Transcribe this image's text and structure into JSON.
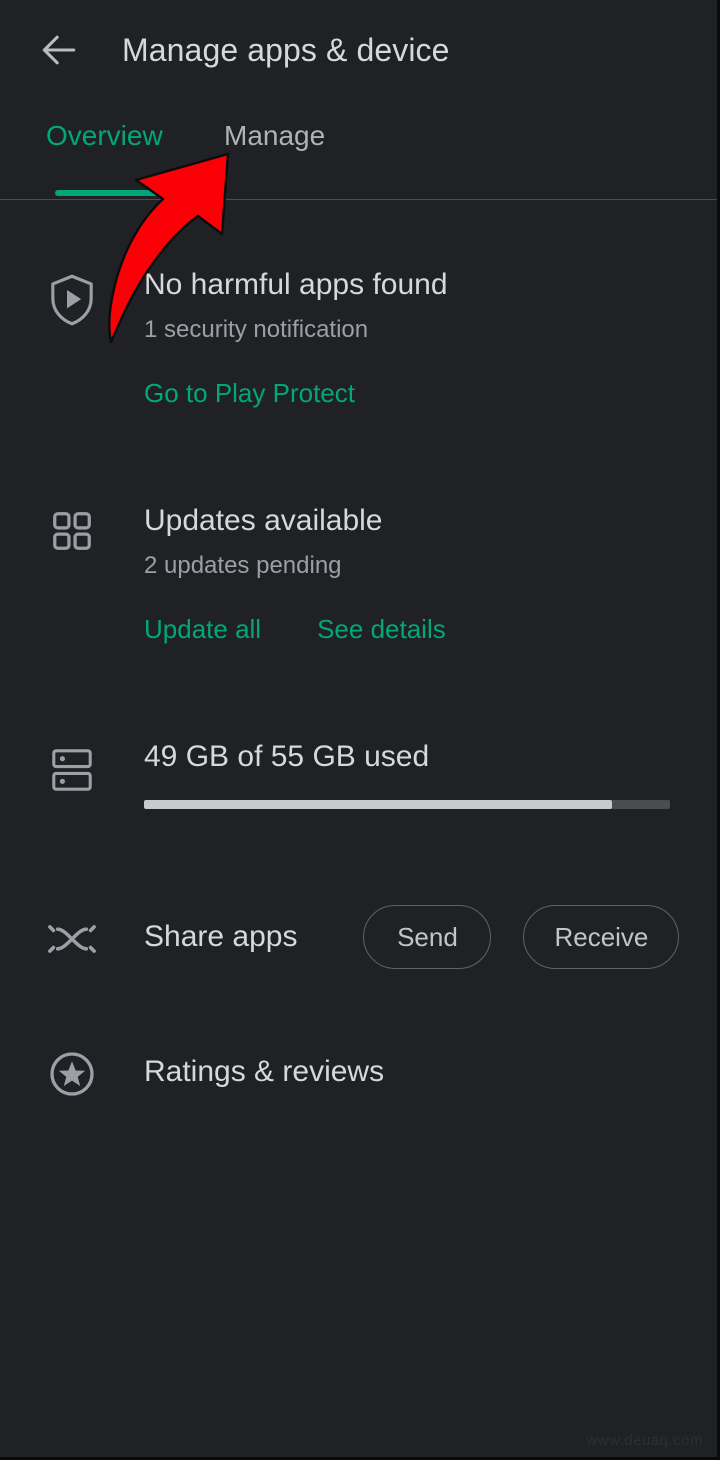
{
  "app": {
    "title": "Manage apps & device",
    "background_color": "#202124",
    "accent_color": "#00a878"
  },
  "appbar": {
    "back_icon": "arrow-left-icon",
    "title": "Manage apps & device"
  },
  "tabs": {
    "items": [
      {
        "label": "Overview",
        "selected": true
      },
      {
        "label": "Manage",
        "selected": false
      }
    ],
    "overview_label": "Overview",
    "manage_label": "Manage"
  },
  "sections": {
    "play_protect": {
      "icon": "shield-play-icon",
      "title": "No harmful apps found",
      "subtitle": "1 security notification",
      "action_label": "Go to Play Protect"
    },
    "updates": {
      "icon": "apps-grid-icon",
      "title": "Updates available",
      "subtitle": "2 updates pending",
      "action_update_all": "Update all",
      "action_see_details": "See details"
    },
    "storage": {
      "icon": "storage-icon",
      "title": "49 GB of 55 GB used",
      "used_gb": 49,
      "total_gb": 55,
      "percent_used": 89
    },
    "share_apps": {
      "icon": "nearby-share-icon",
      "label": "Share apps",
      "send_label": "Send",
      "receive_label": "Receive"
    },
    "ratings": {
      "icon": "star-circle-icon",
      "label": "Ratings & reviews"
    }
  },
  "annotation": {
    "type": "red-curved-arrow",
    "color": "#fb0007",
    "points_to": "Manage"
  },
  "watermark": {
    "text": "www.deuaq.com"
  }
}
